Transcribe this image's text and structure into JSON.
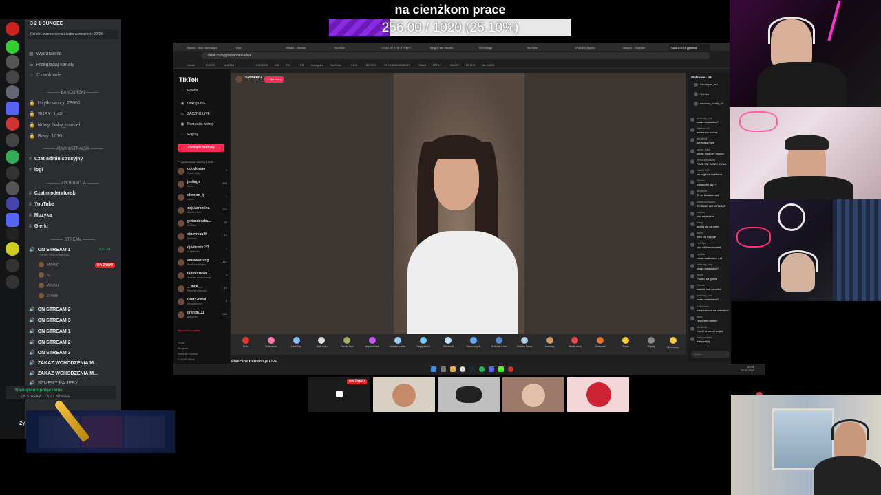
{
  "goal": {
    "title": "na cienżkom prace",
    "progress_text": "256.00 / 1020 (25.10%)",
    "progress_fraction": 0.251,
    "fill_color": "#8a2be2"
  },
  "discord": {
    "server_name": "3 2 1 BUNGEE",
    "boost_text": "Cel dot. wzmocnienia  Liczba wzmocnień: 22/28",
    "top_items": [
      "Wydarzenia",
      "Przeglądaj kanały",
      "Członkowie"
    ],
    "categories": {
      "banturski": "BANDURSKI",
      "admin": "ADMINISTRACJA",
      "moderacja": "MODERACJA",
      "stream": "STREAM"
    },
    "stats": [
      "Użytkownicy: 29061",
      "SUBY: 1,4K",
      "Nowy: baby_marcel.",
      "Bany: 1010"
    ],
    "admin_channels": [
      "Czat-administracyjny",
      "logi"
    ],
    "mod_channels": [
      "Czat-moderatorski",
      "YouTube",
      "Muzyka",
      "Gierki"
    ],
    "voice_channel": "ON STREAM 1",
    "voice_status": "Ustaw status kanału",
    "voice_time": "0:01:04",
    "live_badge": "NA ŻYWO",
    "voice_users": [
      "MARIO",
      "n...",
      "Wlodar",
      "Zyniak"
    ],
    "more_channels": [
      "ON STREAM 2",
      "ON STREAM 3",
      "ON STREAM 1",
      "ON STREAM 2",
      "ON STREAM 3",
      "ZAKAZ WCHODZENIA M...",
      "ZAKAZ WCHODZENIA M...",
      "SZMERY PA JEBY"
    ],
    "connection_status": "Nawiązano połączenie",
    "connection_channel": "ON STREAM 1 / 3 2 1 BUNGEE",
    "user_short": "Zy"
  },
  "browser": {
    "tabs": [
      "Stream - Kick Dashboard",
      "Kick",
      "Wlodar - Stream",
      "YouTube",
      "KING OF THE STREET",
      "King of the Streets",
      "YOO Kings",
      "YouTube",
      "UPADEK Zbyrko",
      "sewpro - YouTube",
      "SANDERKA (@tiktok"
    ],
    "url": "tiktok.com/@tiksanderka/live",
    "bookmarks": [
      "Gmail",
      "DOCS",
      "MATMA",
      "KKODZIK",
      "CK",
      "PC",
      "FB",
      "Instagram",
      "YouTube",
      "KICK",
      "BOTRIX",
      "STREAMELEMENTS",
      "Twitch",
      "TIPPLY",
      "KACZY",
      "TIKTOK",
      "NA KASIA"
    ]
  },
  "tiktok": {
    "logo": "TikTok",
    "search_placeholder": "Powrót",
    "nav": [
      "Odkryj LIVE",
      "ZACZNIJ LIVE",
      "Narzędzia twórcy",
      "Więcej"
    ],
    "coins_button": "Zdobądź Monety",
    "suggested_title": "Proponowani twórcy LIVE",
    "suggested": [
      {
        "name": "dudekwgm",
        "sub": "Dudek Wgm",
        "count": "1"
      },
      {
        "name": "jestingx",
        "sub": "Justin X",
        "count": "500"
      },
      {
        "name": "oliwson_ly",
        "sub": "oliwka",
        "count": "1"
      },
      {
        "name": "ooji.karoolina",
        "sub": "Karolina Bart",
        "count": "221"
      },
      {
        "name": "gwiazdeczka...",
        "sub": "MAGDA",
        "count": "24"
      },
      {
        "name": "cinevreau30",
        "sub": "Sviatova",
        "count": "10"
      },
      {
        "name": "djnelomix123",
        "sub": "Dj Nelo Mix",
        "count": "1"
      },
      {
        "name": "amelwashing...",
        "sub": "Amel Washington",
        "count": "121"
      },
      {
        "name": "tadeuszlewa...",
        "sub": "Tadeusz Lewandowski",
        "count": "4"
      },
      {
        "name": "__mkk__",
        "sub": "Princess Rzeszow",
        "count": "10"
      },
      {
        "name": "user226804...",
        "sub": "Skrzypek2000",
        "count": "9"
      },
      {
        "name": "grandn111",
        "sub": "grandn96",
        "count": "411"
      }
    ],
    "see_all": "Wyświetl wszystko",
    "footer": [
      "Firma",
      "Program",
      "Warunki i polityki",
      "© 2025 TikTok"
    ],
    "streamer": "SANDERKA",
    "follow": "+ Obserwuj",
    "gifts": [
      "Róża",
      "Pole serca",
      "Heel Pop",
      "Biała róża",
      "Okrutki heel",
      "Impreza heel",
      "Chłodna szklan.",
      "Ciepły drinka",
      "Biła kostki",
      "Zamrożony kl.",
      "Królowie Lodu",
      "Lodowe Serce",
      "Amoresp",
      "Wielki serca",
      "Kozaczek",
      "Super",
      "Więcej"
    ],
    "recharge": "Recharge",
    "viewers_title": "Widzowie · 43",
    "viewers": [
      "klauclyper_kro",
      "Tefulka",
      "wieczne_kwiaty_ch"
    ],
    "chat": [
      {
        "u": "ambrozy_nbo",
        "t": "znasz mlokolake?"
      },
      {
        "u": "Matthew M",
        "t": "wlodar cie kocha"
      },
      {
        "u": "iiiiiiiiiiiiiiiiii",
        "t": "Ale masz ryjek"
      },
      {
        "u": "bartek_kilke",
        "t": "sobek pyta czy mozna"
      },
      {
        "u": "mrstangrubasek",
        "t": "RAJD OD WITEK ZYNA"
      },
      {
        "u": "DawiD 314",
        "t": "sin wyjdzia dojebana"
      },
      {
        "u": "Wlodar",
        "t": "pobawimy się??"
      },
      {
        "u": "iiiiiiiiiiiiiiiiii",
        "t": "To od Daalsta rajd"
      },
      {
        "u": "mariangrubasek",
        "t": "TO RAJD OD WITKA Z"
      },
      {
        "u": "redwcz",
        "t": "rajd od stolima"
      },
      {
        "u": "kroog",
        "t": "wyciąj się na mnie"
      },
      {
        "u": "darek",
        "t": "nitro cię najduje"
      },
      {
        "u": "PeHSpy",
        "t": "rajd od therobszyna"
      },
      {
        "u": "shnilow",
        "t": "robert malkowicz rud"
      },
      {
        "u": "ambrozy_nbo",
        "t": "znasz mlokolake?"
      },
      {
        "u": "akshe",
        "t": "Pozdro od groza"
      },
      {
        "u": "Piotrek",
        "t": "maciek ma mieszko"
      },
      {
        "u": "ambrozy_nbo",
        "t": "znasz mlokolake?"
      },
      {
        "u": "TTRAimno",
        "t": "wlodar może na okiembo?"
      },
      {
        "u": "igrcfs",
        "t": "Hej rijellet minta?"
      },
      {
        "u": "iiiiiiiiiiiiiiiiii",
        "t": "Dordit to kamzi wojtek"
      },
      {
        "u": "jozef_stolmilo",
        "t": "dołączył(a)"
      }
    ],
    "chat_placeholder": "Wpisz...",
    "recommended": "Polecane transmisje LIVE"
  },
  "taskbar": {
    "clock_time": "03:31",
    "clock_date": "23.11.2025"
  },
  "thumbs": {
    "live_badge": "NA ŻYWO"
  },
  "colors": {
    "tiktok_accent": "#fe2c55",
    "discord_bg": "#2b2d31",
    "live_red": "#e52525",
    "discord_green": "#3ba55c"
  }
}
